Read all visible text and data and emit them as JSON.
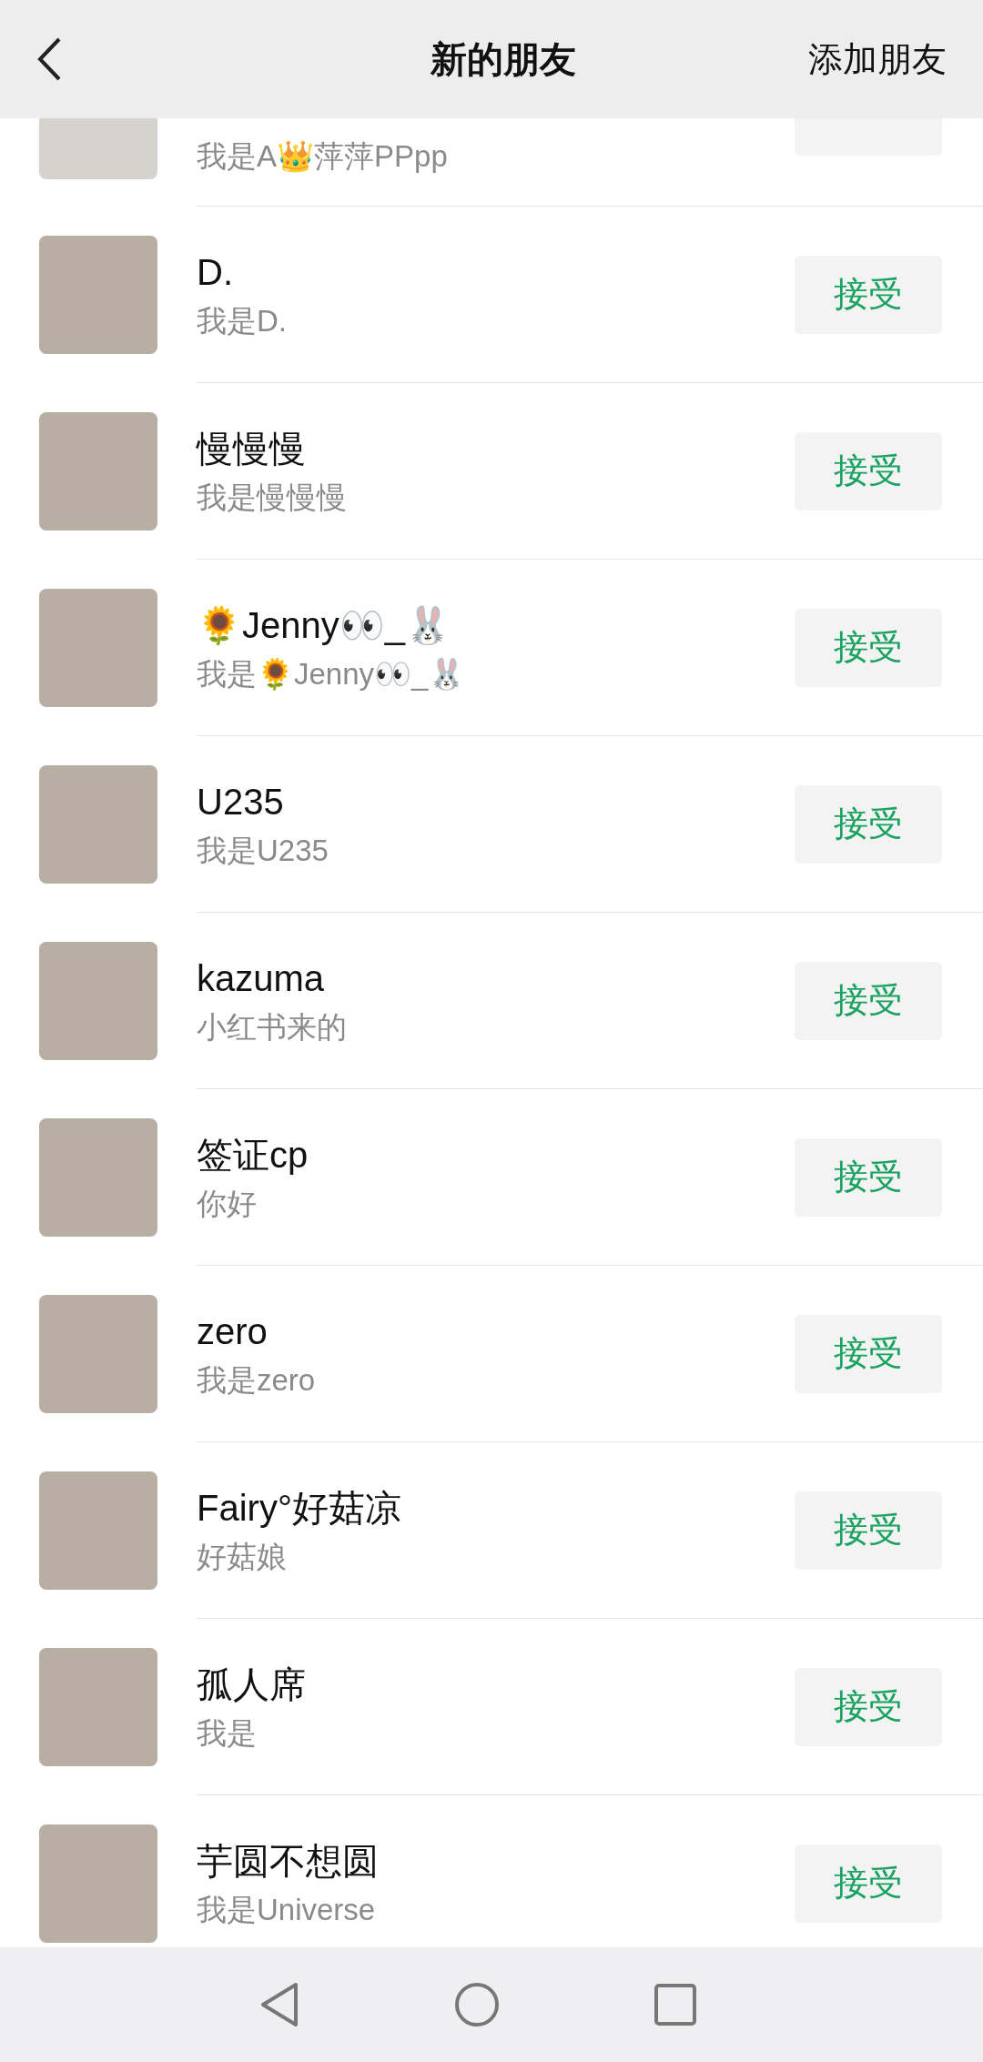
{
  "header": {
    "title": "新的朋友",
    "action": "添加朋友"
  },
  "requests": [
    {
      "message": "我是A👑萍萍PPpp"
    },
    {
      "name": "D.",
      "message": "我是D.",
      "button": "接受"
    },
    {
      "name": "慢慢慢",
      "message": "我是慢慢慢",
      "button": "接受"
    },
    {
      "name": "🌻Jenny👀_🐰",
      "message": "我是🌻Jenny👀_🐰",
      "button": "接受"
    },
    {
      "name": "U235",
      "message": "我是U235",
      "button": "接受"
    },
    {
      "name": "kazuma",
      "message": "小红书来的",
      "button": "接受"
    },
    {
      "name": "签证cp",
      "message": "你好",
      "button": "接受"
    },
    {
      "name": "zero",
      "message": "我是zero",
      "button": "接受"
    },
    {
      "name": "Fairy°好菇凉",
      "message": "好菇娘",
      "button": "接受"
    },
    {
      "name": "孤人席",
      "message": "我是",
      "button": "接受"
    },
    {
      "name": "芋圆不想圆",
      "message": "我是Universe",
      "button": "接受"
    }
  ]
}
